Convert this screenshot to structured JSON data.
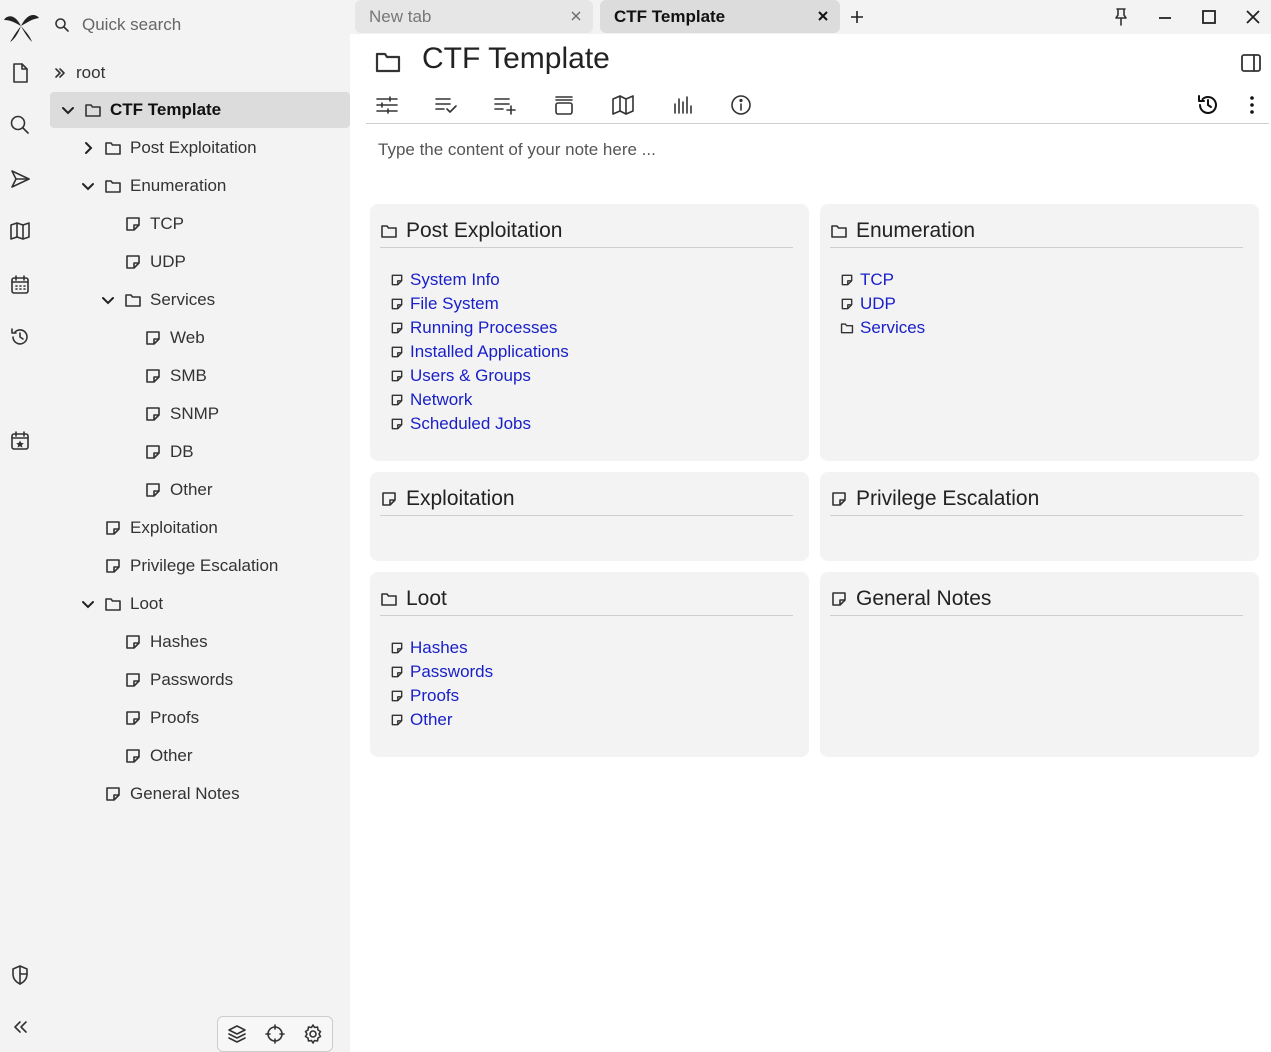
{
  "search": {
    "placeholder": "Quick search"
  },
  "tree": {
    "root_label": "root",
    "items": [
      {
        "label": "CTF Template",
        "type": "folder",
        "expanded": true,
        "active": true
      },
      {
        "label": "Post Exploitation",
        "type": "folder",
        "expanded": false
      },
      {
        "label": "Enumeration",
        "type": "folder",
        "expanded": true
      },
      {
        "label": "TCP",
        "type": "note"
      },
      {
        "label": "UDP",
        "type": "note"
      },
      {
        "label": "Services",
        "type": "folder",
        "expanded": true
      },
      {
        "label": "Web",
        "type": "note"
      },
      {
        "label": "SMB",
        "type": "note"
      },
      {
        "label": "SNMP",
        "type": "note"
      },
      {
        "label": "DB",
        "type": "note"
      },
      {
        "label": "Other",
        "type": "note"
      },
      {
        "label": "Exploitation",
        "type": "note"
      },
      {
        "label": "Privilege Escalation",
        "type": "note"
      },
      {
        "label": "Loot",
        "type": "folder",
        "expanded": true
      },
      {
        "label": "Hashes",
        "type": "note"
      },
      {
        "label": "Passwords",
        "type": "note"
      },
      {
        "label": "Proofs",
        "type": "note"
      },
      {
        "label": "Other",
        "type": "note"
      },
      {
        "label": "General Notes",
        "type": "note"
      }
    ]
  },
  "tabs": [
    {
      "label": "New tab",
      "active": false
    },
    {
      "label": "CTF Template",
      "active": true
    }
  ],
  "note": {
    "title": "CTF Template",
    "content_placeholder": "Type the content of your note here ..."
  },
  "cards": [
    {
      "title": "Post Exploitation",
      "type": "folder",
      "children": [
        {
          "label": "System Info",
          "type": "note"
        },
        {
          "label": "File System",
          "type": "note"
        },
        {
          "label": "Running Processes",
          "type": "note"
        },
        {
          "label": "Installed Applications",
          "type": "note"
        },
        {
          "label": "Users & Groups",
          "type": "note"
        },
        {
          "label": "Network",
          "type": "note"
        },
        {
          "label": "Scheduled Jobs",
          "type": "note"
        }
      ]
    },
    {
      "title": "Enumeration",
      "type": "folder",
      "children": [
        {
          "label": "TCP",
          "type": "note"
        },
        {
          "label": "UDP",
          "type": "note"
        },
        {
          "label": "Services",
          "type": "folder"
        }
      ]
    },
    {
      "title": "Exploitation",
      "type": "note",
      "children": []
    },
    {
      "title": "Privilege Escalation",
      "type": "note",
      "children": []
    },
    {
      "title": "Loot",
      "type": "folder",
      "children": [
        {
          "label": "Hashes",
          "type": "note"
        },
        {
          "label": "Passwords",
          "type": "note"
        },
        {
          "label": "Proofs",
          "type": "note"
        },
        {
          "label": "Other",
          "type": "note"
        }
      ]
    },
    {
      "title": "General Notes",
      "type": "note",
      "children": []
    }
  ],
  "icons": {
    "rail": [
      "trilium-logo-icon",
      "new-note-icon",
      "search-icon",
      "send-icon",
      "map-icon",
      "calendar-icon",
      "history-icon",
      "today-icon",
      "shield-icon",
      "collapse-icon"
    ],
    "ribbon": [
      "options-icon",
      "promoted-attributes-icon",
      "add-attribute-icon",
      "similar-notes-icon",
      "note-map-icon",
      "note-info-stats-icon",
      "info-icon"
    ]
  },
  "colors": {
    "link": "#1a20c8",
    "pane_bg": "#f3f3f3",
    "active_row": "#dcdcdc"
  }
}
